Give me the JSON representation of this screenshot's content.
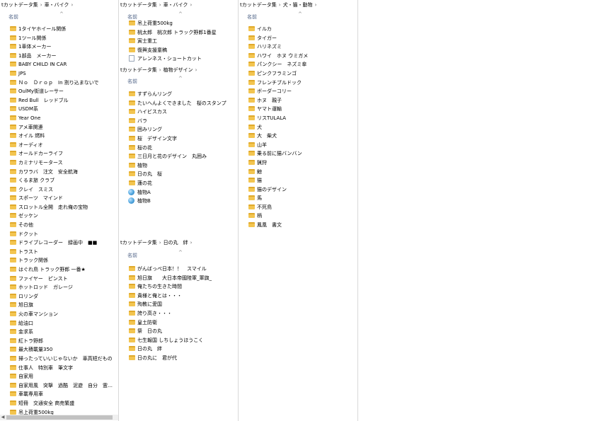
{
  "panes": {
    "car_bike": {
      "breadcrumb": [
        "tカットデータ集",
        "車・バイク"
      ],
      "column_header": "名前",
      "items": [
        "1タイヤホイール関係",
        "1ツール関係",
        "1車体メーカー",
        "1部品　メーカー",
        "BABY CHILD IN CAR",
        "JPS",
        "Ｎｏ　Ｄｒｏｐ　In 割り込まないで",
        "OulMy街道レーサー",
        "Red Bull　レッドブル",
        "USDM系",
        "Year One",
        "アメ車関連",
        "オイル 燃料",
        "オーディオ",
        "オールドカーライフ",
        "カミナリモータース",
        "カワラバ　注文　安全航海",
        "くるま旅 クラブ",
        "クレイ　スミス",
        "スポーツ　マインド",
        "スロットル全開　走れ俺の宝物",
        "ゼッケン",
        "その他",
        "ドクット",
        "ドライブレコーダー　録画中　■■",
        "トラスト",
        "トラック関係",
        "はぐれ鳥 トラック野郎 一番★",
        "ファイヤー　ピンスト",
        "ホットロッド　ガレージ",
        "ロリンダ",
        "旭日旗",
        "火の車マンション",
        "給油口",
        "金求系",
        "紅トラ野郎",
        "最大積載量350",
        "掃ったっていいじゃないか　車高短だもの",
        "仕事人　特別車　筆文字",
        "自家用",
        "自家用風　突撃　過酷　泥遊　自分　霊…",
        "車載専用車",
        "短冊　交通安全 商売繁盛",
        "吊上荷重500kg"
      ]
    },
    "car_bike_2": {
      "breadcrumb": [
        "tカットデータ集",
        "車・バイク"
      ],
      "column_header": "名前",
      "items": [
        {
          "label": "吊上荷重500kg",
          "icon": "folder"
        },
        {
          "label": "桃太郎　桃次郎 トラック野郎1番星",
          "icon": "folder"
        },
        {
          "label": "寅士重工",
          "icon": "folder"
        },
        {
          "label": "復興支援童稿",
          "icon": "folder"
        },
        {
          "label": "アレンネス・ショートカット",
          "icon": "file"
        }
      ]
    },
    "plants": {
      "breadcrumb": [
        "tカットデータ集",
        "植物デザイン"
      ],
      "column_header": "名前",
      "items": [
        {
          "label": "すずらんリング",
          "icon": "folder"
        },
        {
          "label": "たいへんよくできました　桜のスタンプ",
          "icon": "folder"
        },
        {
          "label": "ハイビスカス",
          "icon": "folder"
        },
        {
          "label": "バラ",
          "icon": "folder"
        },
        {
          "label": "囲みリング",
          "icon": "folder"
        },
        {
          "label": "桜　デザイン文字",
          "icon": "folder"
        },
        {
          "label": "桜の花",
          "icon": "folder"
        },
        {
          "label": "三日月と花のデザイン　丸囲み",
          "icon": "folder"
        },
        {
          "label": "植物",
          "icon": "folder"
        },
        {
          "label": "日の丸　桜",
          "icon": "folder"
        },
        {
          "label": "蓮の花",
          "icon": "folder"
        },
        {
          "label": "植物A",
          "icon": "app"
        },
        {
          "label": "植物B",
          "icon": "app"
        }
      ]
    },
    "hinomaru": {
      "breadcrumb": [
        "tカットデータ集",
        "日の丸　絆"
      ],
      "column_header": "名前",
      "items": [
        "がんばっぺ日本！！　スマイル",
        "旭日旗　　大日本帝國陸軍_軍旗_",
        "俺たちの生きた時間",
        "貴様と俺とは・・・",
        "殉教に愛国",
        "誇り高き・・・",
        "皇土防衛",
        "祭　日の丸",
        "七生報国 しちしょうほうこく",
        "日の丸　絆",
        "日の丸に　君が代"
      ]
    },
    "animals": {
      "breadcrumb": [
        "tカットデータ集",
        "犬・猫・動物"
      ],
      "column_header": "名前",
      "items": [
        "イルカ",
        "タイガー",
        "ハリネズミ",
        "ハワイ　ホヌ ウミガメ",
        "パンクシー　ネズミ傘",
        "ピンクフラミンゴ",
        "フレンチブルドック",
        "ボーダーコリー",
        "ホヌ　親子",
        "ヤマト運輸",
        "リスTULALA",
        "犬",
        "大　柴犬",
        "山羊",
        "乗る前に猫バンバン",
        "猟狩",
        "鯨",
        "猫",
        "猫のデザイン",
        "馬",
        "不死鳥",
        "柄",
        "鳳凰　書文"
      ]
    }
  }
}
